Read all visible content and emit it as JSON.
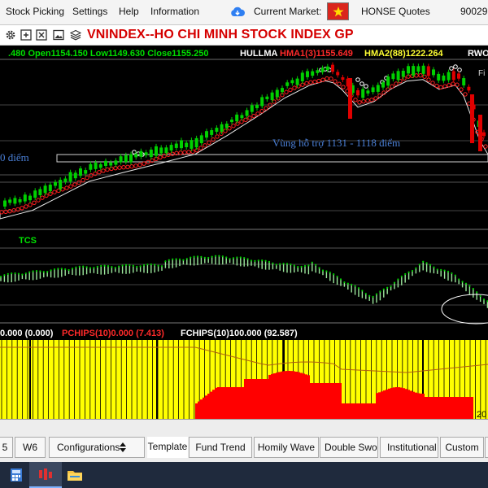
{
  "menubar": {
    "items": [
      "Stock Picking",
      "Settings",
      "Help",
      "Information"
    ],
    "current_market_label": "Current Market:",
    "market_name": "HONSE Quotes",
    "account_fragment": "90029"
  },
  "toolbar": {
    "icons": [
      "gear-icon",
      "add-icon",
      "close-icon",
      "image-icon",
      "layers-icon"
    ]
  },
  "chart": {
    "title": "VNINDEX--HO CHI MINH STOCK INDEX  GP",
    "ohlc_text": ".480 Open1154.150 Low1149.630 Close1155.250",
    "indicator_name": "HULLMA",
    "hma1_text": "HMA1(3)1155.649",
    "hma2_text": "HMA2(88)1222.264",
    "corner_label": "RWO",
    "corner_small_label": "Fi",
    "support_label": "Vùng hỗ trợ 1131 - 1118 điểm",
    "left_zone_label": "0 điểm",
    "tcs_label": "TCS",
    "bottom_fragment_1": "0.000 (0.000)",
    "bottom_fragment_2": "PCHIPS(10)0.000 (7.413)",
    "bottom_fragment_3": "FCHIPS(10)100.000 (92.587)",
    "date_fragment": "20",
    "colors": {
      "up_candle": "#00d000",
      "down_candle": "#e00000",
      "hma": "#ff2020",
      "zone_line": "#ffffff",
      "support_text": "#4a7fd6",
      "hist_yellow": "#ffff00",
      "hist_red": "#ff0000"
    }
  },
  "tabs": [
    {
      "label": "5",
      "active": false
    },
    {
      "label": "W6",
      "active": false
    },
    {
      "label": "Configurations",
      "active": false
    },
    {
      "label": "Template",
      "active": true
    },
    {
      "label": "Fund Trend",
      "active": false
    },
    {
      "label": "Homily Wave",
      "active": false
    },
    {
      "label": "Double Sword",
      "active": false
    },
    {
      "label": "Institutional Accumulation",
      "active": false
    },
    {
      "label": "Custom",
      "active": false
    }
  ],
  "taskbar": {
    "apps": [
      "calculator-icon",
      "stock-app-icon",
      "file-explorer-icon"
    ]
  }
}
